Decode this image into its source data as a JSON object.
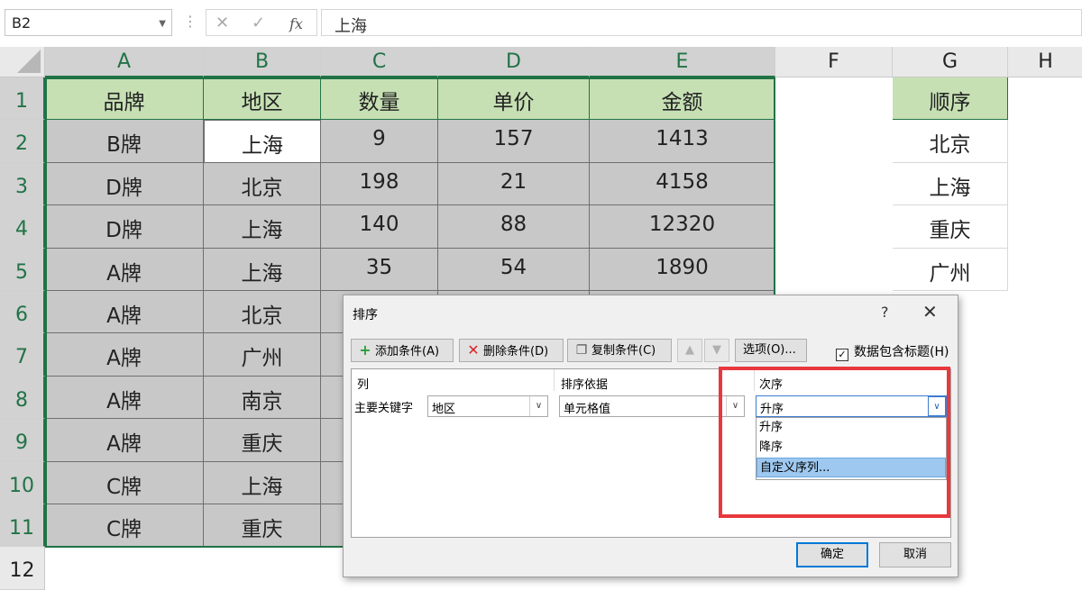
{
  "formula_bar": {
    "name_box": "B2",
    "cancel_icon": "✕",
    "enter_icon": "✓",
    "fx_label": "fx",
    "value": "上海"
  },
  "columns": [
    "A",
    "B",
    "C",
    "D",
    "E",
    "F",
    "G",
    "H"
  ],
  "rows": [
    "1",
    "2",
    "3",
    "4",
    "5",
    "6",
    "7",
    "8",
    "9",
    "10",
    "11",
    "12"
  ],
  "table": {
    "headers": [
      "品牌",
      "地区",
      "数量",
      "单价",
      "金额"
    ],
    "rows": [
      [
        "B牌",
        "上海",
        "9",
        "157",
        "1413"
      ],
      [
        "D牌",
        "北京",
        "198",
        "21",
        "4158"
      ],
      [
        "D牌",
        "上海",
        "140",
        "88",
        "12320"
      ],
      [
        "A牌",
        "上海",
        "35",
        "54",
        "1890"
      ],
      [
        "A牌",
        "北京",
        "",
        "",
        ""
      ],
      [
        "A牌",
        "广州",
        "",
        "",
        ""
      ],
      [
        "A牌",
        "南京",
        "",
        "",
        ""
      ],
      [
        "A牌",
        "重庆",
        "",
        "",
        ""
      ],
      [
        "C牌",
        "上海",
        "",
        "",
        ""
      ],
      [
        "C牌",
        "重庆",
        "",
        "",
        ""
      ]
    ]
  },
  "order_list": {
    "header": "顺序",
    "items": [
      "北京",
      "上海",
      "重庆",
      "广州"
    ]
  },
  "sort_dialog": {
    "title": "排序",
    "help": "?",
    "close": "✕",
    "add_condition": "添加条件(A)",
    "delete_condition": "删除条件(D)",
    "copy_condition": "复制条件(C)",
    "move_up": "▲",
    "move_down": "▼",
    "options": "选项(O)...",
    "has_headers_label": "数据包含标题(H)",
    "has_headers_checked": true,
    "col_header_column": "列",
    "col_header_sort_on": "排序依据",
    "col_header_order": "次序",
    "primary_key_label": "主要关键字",
    "column_value": "地区",
    "sort_on_value": "单元格值",
    "order_value": "升序",
    "order_options": [
      "升序",
      "降序",
      "自定义序列..."
    ],
    "highlighted_option": "自定义序列...",
    "ok": "确定",
    "cancel": "取消"
  },
  "colors": {
    "header_fill": "#c6e0b4",
    "data_fill": "#c8c8c8",
    "excel_green": "#217346",
    "highlight_red": "#e8383d",
    "option_highlight": "#9ec8ef"
  }
}
